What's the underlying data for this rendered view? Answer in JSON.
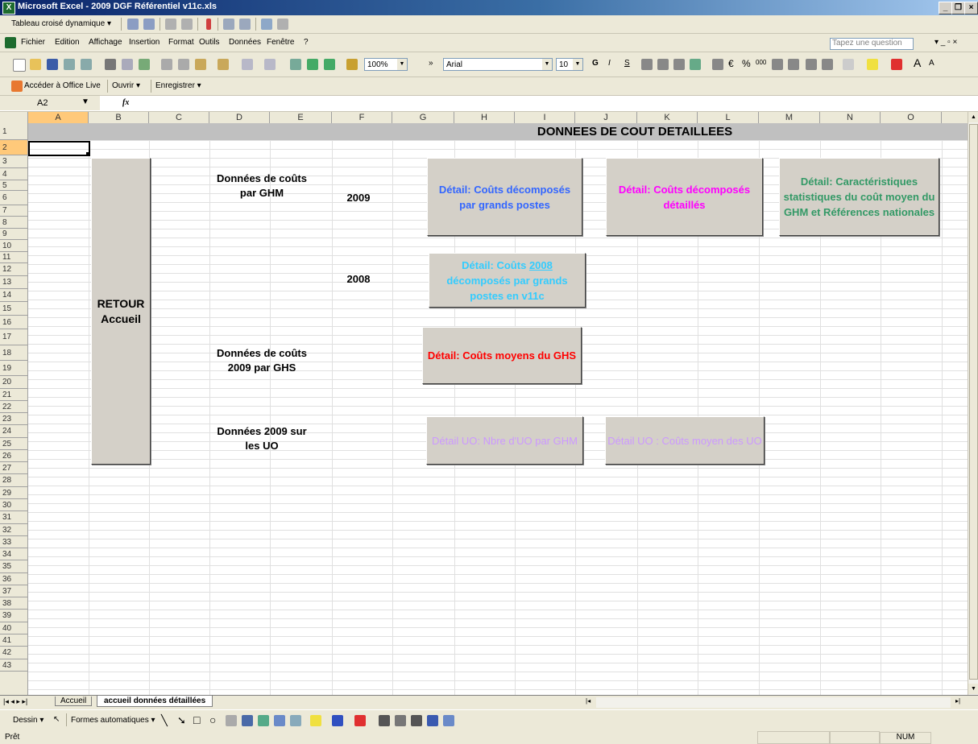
{
  "window": {
    "title": "Microsoft Excel - 2009 DGF Référentiel v11c.xls"
  },
  "pivot_toolbar": {
    "label": "Tableau croisé dynamique ▾"
  },
  "menu": {
    "items": [
      "Fichier",
      "Edition",
      "Affichage",
      "Insertion",
      "Format",
      "Outils",
      "Données",
      "Fenêtre",
      "?"
    ],
    "help_placeholder": "Tapez une question"
  },
  "format_toolbar": {
    "zoom": "100%",
    "font": "Arial",
    "size": "10"
  },
  "office_live": {
    "access": "Accéder à Office Live",
    "open": "Ouvrir ▾",
    "save": "Enregistrer ▾"
  },
  "formula_bar": {
    "name_box": "A2",
    "fx": "fx",
    "value": ""
  },
  "columns": [
    "A",
    "B",
    "C",
    "D",
    "E",
    "F",
    "G",
    "H",
    "I",
    "J",
    "K",
    "L",
    "M",
    "N",
    "O"
  ],
  "rows": [
    "1",
    "2",
    "3",
    "4",
    "5",
    "6",
    "7",
    "8",
    "9",
    "10",
    "11",
    "12",
    "13",
    "14",
    "15",
    "16",
    "17",
    "18",
    "19",
    "20",
    "21",
    "22",
    "23",
    "24",
    "25",
    "26",
    "27",
    "28",
    "29",
    "30",
    "31",
    "32",
    "33",
    "34",
    "35",
    "36",
    "37",
    "38",
    "39",
    "40",
    "41",
    "42",
    "43"
  ],
  "sheet": {
    "title": "DONNEES DE COUT DETAILLEES",
    "retour": "RETOUR Accueil",
    "label_ghm": "Données de coûts par GHM",
    "label_ghs": "Données de coûts 2009 par GHS",
    "label_uo": "Données 2009 sur les UO",
    "year_2009": "2009",
    "year_2008": "2008",
    "btn_grands_postes": "Détail: Coûts décomposés par grands postes",
    "btn_detailles": "Détail: Coûts décomposés détaillés",
    "btn_caracteristiques": "Détail: Caractéristiques statistiques du coût moyen du GHM et Références nationales",
    "btn_2008_pre": "Détail: Coûts ",
    "btn_2008_link": "2008",
    "btn_2008_post": " décomposés par grands postes en v11c",
    "btn_ghs": "Détail: Coûts moyens du GHS",
    "btn_uo_nbre": "Détail UO: Nbre d'UO par GHM",
    "btn_uo_couts": "Détail UO : Coûts moyen des UO"
  },
  "colors": {
    "grands_postes": "#3366ff",
    "detailles": "#ff00ff",
    "caracteristiques": "#339966",
    "year_2008_btn": "#33ccff",
    "ghs": "#ff0000",
    "uo": "#cc99ff"
  },
  "tabs": {
    "accueil": "Accueil",
    "active": "accueil données détaillées"
  },
  "draw_toolbar": {
    "dessin": "Dessin ▾",
    "formes": "Formes automatiques ▾"
  },
  "status": {
    "left": "Prêt",
    "num": "NUM"
  }
}
